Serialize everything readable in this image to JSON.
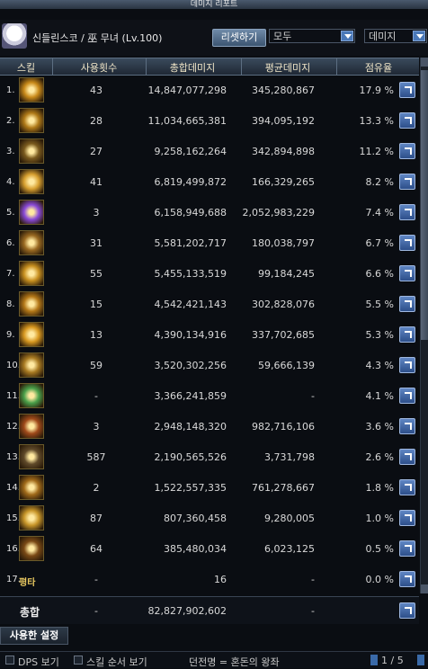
{
  "window": {
    "title": "데미지 리포트"
  },
  "header": {
    "character": "신들린스코 / 巫 무녀 (Lv.100)",
    "reset_label": "리셋하기",
    "filter_select": "모두",
    "sort_select": "데미지"
  },
  "columns": {
    "skill": "스킬",
    "uses": "사용횟수",
    "total": "총합데미지",
    "avg": "평균데미지",
    "share": "점유율"
  },
  "rows": [
    {
      "num": "1.",
      "icon": "skill-icon",
      "uses": "43",
      "total": "14,847,077,298",
      "avg": "345,280,867",
      "share": "17.9 %"
    },
    {
      "num": "2.",
      "icon": "skill-icon",
      "uses": "28",
      "total": "11,034,665,381",
      "avg": "394,095,192",
      "share": "13.3 %"
    },
    {
      "num": "3.",
      "icon": "skill-icon",
      "uses": "27",
      "total": "9,258,162,264",
      "avg": "342,894,898",
      "share": "11.2 %"
    },
    {
      "num": "4.",
      "icon": "skill-icon",
      "uses": "41",
      "total": "6,819,499,872",
      "avg": "166,329,265",
      "share": "8.2 %"
    },
    {
      "num": "5.",
      "icon": "skill-icon",
      "uses": "3",
      "total": "6,158,949,688",
      "avg": "2,052,983,229",
      "share": "7.4 %"
    },
    {
      "num": "6.",
      "icon": "skill-icon",
      "uses": "31",
      "total": "5,581,202,717",
      "avg": "180,038,797",
      "share": "6.7 %"
    },
    {
      "num": "7.",
      "icon": "skill-icon",
      "uses": "55",
      "total": "5,455,133,519",
      "avg": "99,184,245",
      "share": "6.6 %"
    },
    {
      "num": "8.",
      "icon": "skill-icon",
      "uses": "15",
      "total": "4,542,421,143",
      "avg": "302,828,076",
      "share": "5.5 %"
    },
    {
      "num": "9.",
      "icon": "skill-icon",
      "uses": "13",
      "total": "4,390,134,916",
      "avg": "337,702,685",
      "share": "5.3 %"
    },
    {
      "num": "10.",
      "icon": "skill-icon",
      "uses": "59",
      "total": "3,520,302,256",
      "avg": "59,666,139",
      "share": "4.3 %"
    },
    {
      "num": "11.",
      "icon": "skill-icon",
      "uses": "-",
      "total": "3,366,241,859",
      "avg": "-",
      "share": "4.1 %"
    },
    {
      "num": "12.",
      "icon": "skill-icon",
      "uses": "3",
      "total": "2,948,148,320",
      "avg": "982,716,106",
      "share": "3.6 %"
    },
    {
      "num": "13.",
      "icon": "skill-icon",
      "uses": "587",
      "total": "2,190,565,526",
      "avg": "3,731,798",
      "share": "2.6 %"
    },
    {
      "num": "14.",
      "icon": "skill-icon",
      "uses": "2",
      "total": "1,522,557,335",
      "avg": "761,278,667",
      "share": "1.8 %"
    },
    {
      "num": "15.",
      "icon": "skill-icon",
      "uses": "87",
      "total": "807,360,458",
      "avg": "9,280,005",
      "share": "1.0 %"
    },
    {
      "num": "16.",
      "icon": "skill-icon",
      "uses": "64",
      "total": "385,480,034",
      "avg": "6,023,125",
      "share": "0.5 %"
    },
    {
      "num": "17.",
      "icon": "평타",
      "uses": "-",
      "total": "16",
      "avg": "-",
      "share": "0.0 %"
    }
  ],
  "totals": {
    "label": "총합",
    "uses": "-",
    "total": "82,827,902,602",
    "avg": "-"
  },
  "settings_label": "사용한 설정",
  "footer": {
    "dps_label": "DPS 보기",
    "skill_order_label": "스킬 순서 보기",
    "dungeon": "던전명 = 혼돈의 왕좌",
    "page": "1 / 5"
  },
  "colors": {
    "accent": "#4a78b8",
    "header_text": "#f0e6c8"
  }
}
